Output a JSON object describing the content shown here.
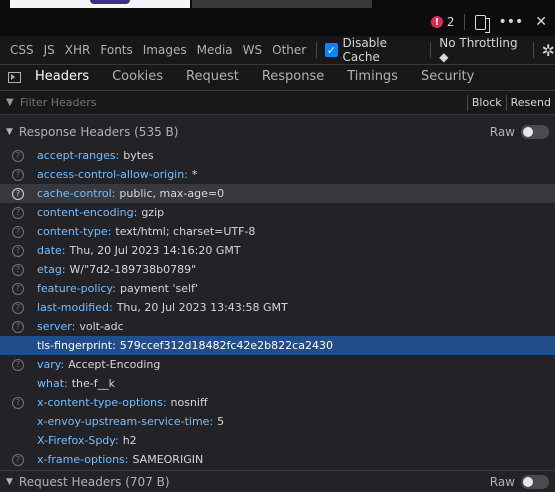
{
  "toolbar": {
    "error_count": "2",
    "more_label": "•••",
    "close_label": "✕"
  },
  "filters": {
    "types": [
      "CSS",
      "JS",
      "XHR",
      "Fonts",
      "Images",
      "Media",
      "WS",
      "Other"
    ],
    "disable_cache_label": "Disable Cache",
    "disable_cache_checked": true,
    "throttling_label": "No Throttling ◆"
  },
  "tabs": [
    "Headers",
    "Cookies",
    "Request",
    "Response",
    "Timings",
    "Security"
  ],
  "active_tab": "Headers",
  "filter_bar": {
    "placeholder": "Filter Headers",
    "block_label": "Block",
    "resend_label": "Resend"
  },
  "response_headers": {
    "title": "Response Headers (535 B)",
    "raw_label": "Raw",
    "rows": [
      {
        "key": "accept-ranges:",
        "value": "bytes",
        "help": true
      },
      {
        "key": "access-control-allow-origin:",
        "value": "*",
        "help": true
      },
      {
        "key": "cache-control:",
        "value": "public, max-age=0",
        "help": true,
        "state": "hover"
      },
      {
        "key": "content-encoding:",
        "value": "gzip",
        "help": true
      },
      {
        "key": "content-type:",
        "value": "text/html; charset=UTF-8",
        "help": true
      },
      {
        "key": "date:",
        "value": "Thu, 20 Jul 2023 14:16:20 GMT",
        "help": true
      },
      {
        "key": "etag:",
        "value": "W/\"7d2-189738b0789\"",
        "help": true
      },
      {
        "key": "feature-policy:",
        "value": "payment 'self'",
        "help": true
      },
      {
        "key": "last-modified:",
        "value": "Thu, 20 Jul 2023 13:43:58 GMT",
        "help": true
      },
      {
        "key": "server:",
        "value": "volt-adc",
        "help": true
      },
      {
        "key": "tls-fingerprint:",
        "value": "579ccef312d18482fc42e2b822ca2430",
        "help": false,
        "state": "selected"
      },
      {
        "key": "vary:",
        "value": "Accept-Encoding",
        "help": true
      },
      {
        "key": "what:",
        "value": "the-f__k",
        "help": false
      },
      {
        "key": "x-content-type-options:",
        "value": "nosniff",
        "help": true
      },
      {
        "key": "x-envoy-upstream-service-time:",
        "value": "5",
        "help": false
      },
      {
        "key": "X-Firefox-Spdy:",
        "value": "h2",
        "help": false
      },
      {
        "key": "x-frame-options:",
        "value": "SAMEORIGIN",
        "help": true
      }
    ]
  },
  "request_headers": {
    "title": "Request Headers (707 B)",
    "raw_label": "Raw"
  }
}
